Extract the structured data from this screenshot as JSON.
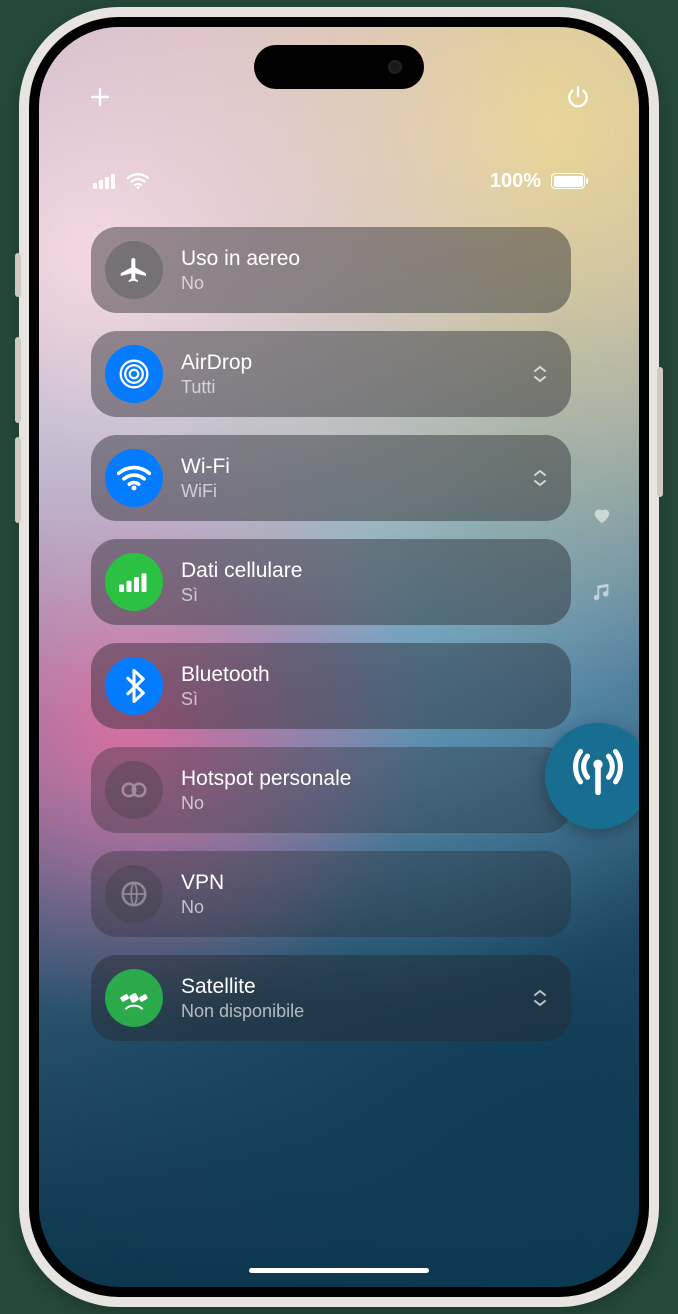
{
  "status": {
    "battery_pct": "100%"
  },
  "rows": {
    "airplane": {
      "title": "Uso in aereo",
      "sub": "No"
    },
    "airdrop": {
      "title": "AirDrop",
      "sub": "Tutti"
    },
    "wifi": {
      "title": "Wi-Fi",
      "sub": "WiFi"
    },
    "cellular": {
      "title": "Dati cellulare",
      "sub": "Sì"
    },
    "bluetooth": {
      "title": "Bluetooth",
      "sub": "Sì"
    },
    "hotspot": {
      "title": "Hotspot personale",
      "sub": "No"
    },
    "vpn": {
      "title": "VPN",
      "sub": "No"
    },
    "satellite": {
      "title": "Satellite",
      "sub": "Non disponibile"
    }
  }
}
